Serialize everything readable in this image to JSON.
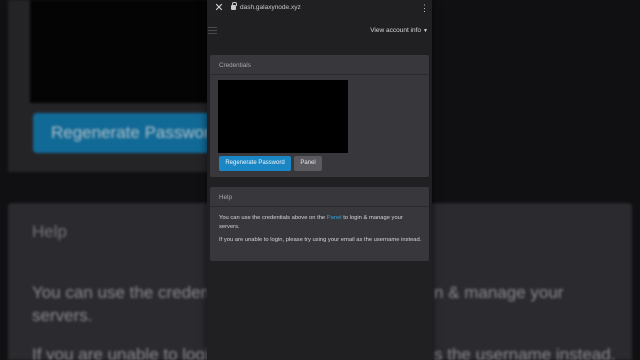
{
  "browser": {
    "url": "dash.galaxynode.xyz",
    "close_icon": "close-icon",
    "more_icon": "more-vertical-icon"
  },
  "header": {
    "account_label": "View account info",
    "menu_icon": "hamburger-menu-icon"
  },
  "credentials": {
    "title": "Credentials",
    "regenerate_label": "Regenerate Password",
    "panel_label": "Panel"
  },
  "help": {
    "title": "Help",
    "p1_before": "You can use the credentials above on the ",
    "p1_link": "Panel",
    "p1_after": " to login & manage your servers.",
    "p2": "If you are unable to login, please try using your email as the username instead."
  },
  "background": {
    "regen_label": "Regenerate Password",
    "help_title": "Help",
    "line1_left": "You can use the credent",
    "line1_right": "n & manage your",
    "line1b": "servers.",
    "line2_left": "If you are unable to logi",
    "line2_right": "s the username instead."
  },
  "colors": {
    "accent": "#1a86c4",
    "link": "#2ea6e0",
    "panel_bg": "#37373c",
    "page_bg": "#202023"
  }
}
